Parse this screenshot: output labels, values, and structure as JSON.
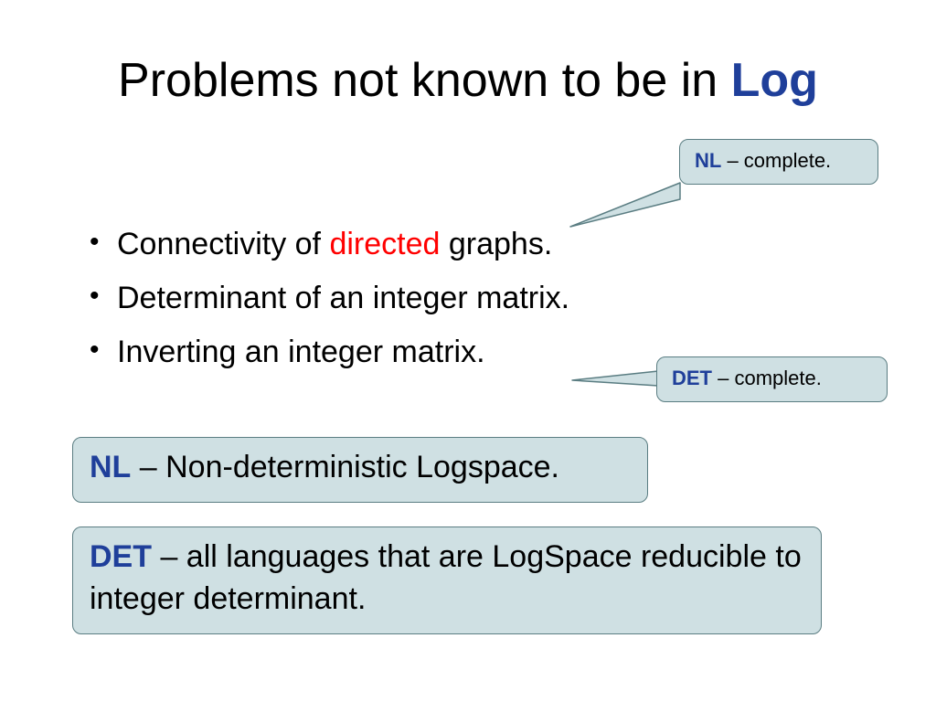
{
  "title": {
    "pre": "Problems not known to be in ",
    "log": "Log"
  },
  "bullets": {
    "b1_pre": "Connectivity of ",
    "b1_dir": "directed",
    "b1_post": " graphs.",
    "b2": "Determinant of an integer matrix.",
    "b3": "Inverting an integer matrix."
  },
  "callouts": {
    "nl_kw": "NL",
    "nl_rest": " – complete.",
    "det_kw": "DET",
    "det_rest": " – complete."
  },
  "defs": {
    "nl_kw": "NL",
    "nl_rest": " – Non-deterministic Logspace.",
    "det_kw": "DET",
    "det_rest": " – all languages that are LogSpace reducible to integer determinant."
  }
}
